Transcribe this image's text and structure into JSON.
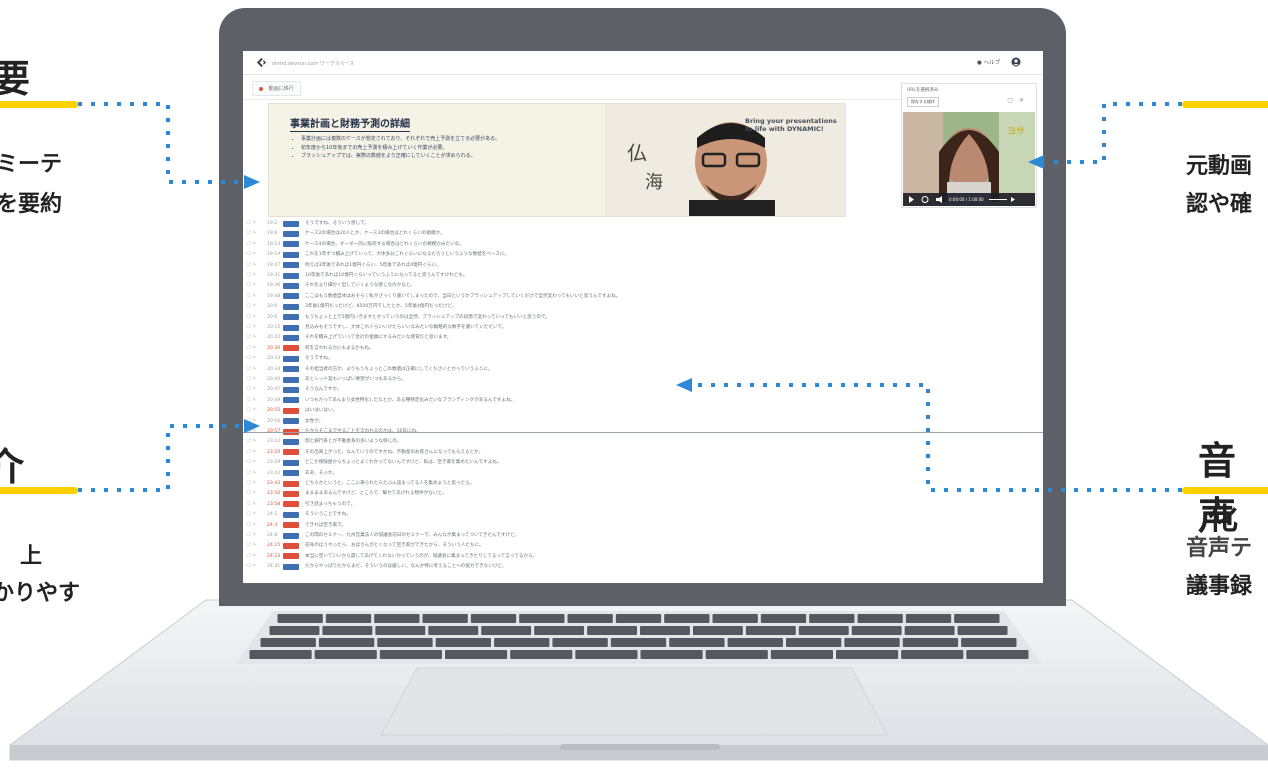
{
  "app": {
    "url": "ohmd.devsun.com ワークスペース",
    "help_label": "ヘルプ",
    "tab_label": "動画に移行"
  },
  "slide": {
    "title": "事業計画と財務予測の詳細",
    "bullets": [
      "事業計画には複数のケースが想定されており、それぞれで売上予測を立てる必要がある。",
      "初年度から10年後までの売上予測を積み上げていく作業が必要。",
      "ブラッシュアップでは、実際の数値をより正確にしていくことが求められる。"
    ],
    "presenter_caption": "Bring your presentations to life with DYNAMIC!"
  },
  "video_panel": {
    "title": "URLを選択済み",
    "button": "保存する操作",
    "time": "0:00:00 / 1:00:00"
  },
  "transcript": [
    {
      "time": "19:2",
      "tag": "",
      "red": false,
      "text": "そうですね、そういう感じで。"
    },
    {
      "time": "19:8",
      "tag": "",
      "red": false,
      "text": "ケース2の場合は20人とか、ケース3の場合はどれくらいの規模か。"
    },
    {
      "time": "19:14",
      "tag": "",
      "red": false,
      "text": "ケース4の場合、オーダー的に販売する場合はどれくらいの規模かみたいな。"
    },
    {
      "time": "19:19",
      "tag": "",
      "red": false,
      "text": "これを1年ずつ積み上げていって、大体多分これぐらいになるだろうというふうな数値をベースに。"
    },
    {
      "time": "19:27",
      "tag": "",
      "red": false,
      "text": "例えば3年後であれば1億円ぐらい、5年後であれば4億円ぐらい。"
    },
    {
      "time": "19:31",
      "tag": "",
      "red": false,
      "text": "10年後であれば10億円ぐらいっていうふうになってると思うんですけれども。"
    },
    {
      "time": "19:36",
      "tag": "",
      "red": false,
      "text": "それをより細かく出していくような感じなのかなと。"
    },
    {
      "time": "19:48",
      "tag": "",
      "red": false,
      "text": "ここはもう数値自体はおそらく私がざっくり書いてしまったので、当日というかブラッシュアップしていくだけで全然変わってもいいと思うんですよね。"
    },
    {
      "time": "20:0",
      "tag": "",
      "red": false,
      "text": "3年後1億円だったけど、8500万円でしたとか、5年後4億円だったけど。"
    },
    {
      "time": "20:6",
      "tag": "",
      "red": false,
      "text": "もうちょっと上で5億円いきますとかっていうのは全然、ブラッシュアップの段階で変わっていってもいいと思うので。"
    },
    {
      "time": "20:15",
      "tag": "",
      "red": false,
      "text": "見込みもそうですし、大体これぐらいいけたらいいなみたいな概略的な数字を書いていただいて。"
    },
    {
      "time": "20:22",
      "tag": "",
      "red": false,
      "text": "それを積み上げていって合計の金額にするみたいな感覚だと思います。"
    },
    {
      "time": "20:30",
      "tag": "",
      "red": true,
      "text": "何を言われるかにもよるかもね。"
    },
    {
      "time": "20:33",
      "tag": "",
      "red": false,
      "text": "そうですね。"
    },
    {
      "time": "20:34",
      "tag": "",
      "red": false,
      "text": "その担当者の方が、よりもうちょっとこの数値は正確にしてくださいとかっていうふうに。"
    },
    {
      "time": "20:40",
      "tag": "",
      "red": false,
      "text": "あとシッド案もいっぱい要望がいつもあるから。"
    },
    {
      "time": "20:47",
      "tag": "",
      "red": false,
      "text": "そうなんですか。"
    },
    {
      "time": "20:49",
      "tag": "",
      "red": false,
      "text": "いつもだってあんまり女性特化したなとか、ある種特定化みたいなブランディングがあるんですよね。"
    },
    {
      "time": "20:55",
      "tag": "",
      "red": true,
      "text": "はいはいはい。"
    },
    {
      "time": "20:56",
      "tag": "",
      "red": false,
      "text": "女性が。"
    },
    {
      "time": "20:57",
      "tag": "",
      "red": true,
      "text": "だからそこまでやることを言われるのかは、16日にね。"
    },
    {
      "time": "23:12",
      "tag": "",
      "red": false,
      "text": "割と銀行系とか不動産系の多いような感じの。"
    },
    {
      "time": "23:20",
      "tag": "",
      "red": true,
      "text": "その出来上がった、なんていうのですかね、不動産のお客さんになってもらえるとか。"
    },
    {
      "time": "23:29",
      "tag": "",
      "red": false,
      "text": "どこか保険屋からちょっとよくわかってないんですけど、私は、空き家を集めたいんですよね。"
    },
    {
      "time": "23:42",
      "tag": "",
      "red": false,
      "text": "ああ、そっか。"
    },
    {
      "time": "23:43",
      "tag": "",
      "red": true,
      "text": "どちらかというと、ここに来られたらたぶん話まってる人を集めようと思ったら。"
    },
    {
      "time": "23:50",
      "tag": "",
      "red": true,
      "text": "ままままあるんですけど、ところで、撃せてあげれる物件がないと。"
    },
    {
      "time": "23:58",
      "tag": "",
      "red": true,
      "text": "引き話まっちゃうので。"
    },
    {
      "time": "24:1",
      "tag": "",
      "red": false,
      "text": "そういうことですね。"
    },
    {
      "time": "24:3",
      "tag": "",
      "red": true,
      "text": "できれば空き家で。"
    },
    {
      "time": "24:8",
      "tag": "",
      "red": false,
      "text": "この間のセミナー、九州営業法人の協議会前日のセミナーで、みんなが集まってついてきたんですけど。"
    },
    {
      "time": "24:15",
      "tag": "",
      "red": true,
      "text": "前身のほうやったら、おばさんがとくなって空き家ができたから、そういう人たちに。"
    },
    {
      "time": "24:23",
      "tag": "",
      "red": true,
      "text": "本当に空いていいから貸してあげてくれないかっていうのが、協議会に集まってきたりしてるって言ってるから。"
    },
    {
      "time": "24:31",
      "tag": "",
      "red": false,
      "text": "だからやっぱりだからまだ、そういうのは厳しい。なんか特に考えることへの協力できないけど。"
    }
  ],
  "annotations": {
    "left_top": {
      "heading": "要",
      "line1": "ミーテ",
      "line2": "を要約"
    },
    "left_bottom": {
      "heading": "介",
      "line1": "上",
      "line2": "かりやす"
    },
    "right_top": {
      "line1": "元動画",
      "line2": "認や確"
    },
    "right_bottom": {
      "heading1": "音声",
      "heading2": "化",
      "line1": "音声テ",
      "line2": "議事録"
    }
  },
  "colors": {
    "accent_yellow": "#ffd000",
    "arrow_blue": "#2b89d6",
    "tag_blue": "#3e6fb2",
    "tag_red": "#df4f3a"
  }
}
